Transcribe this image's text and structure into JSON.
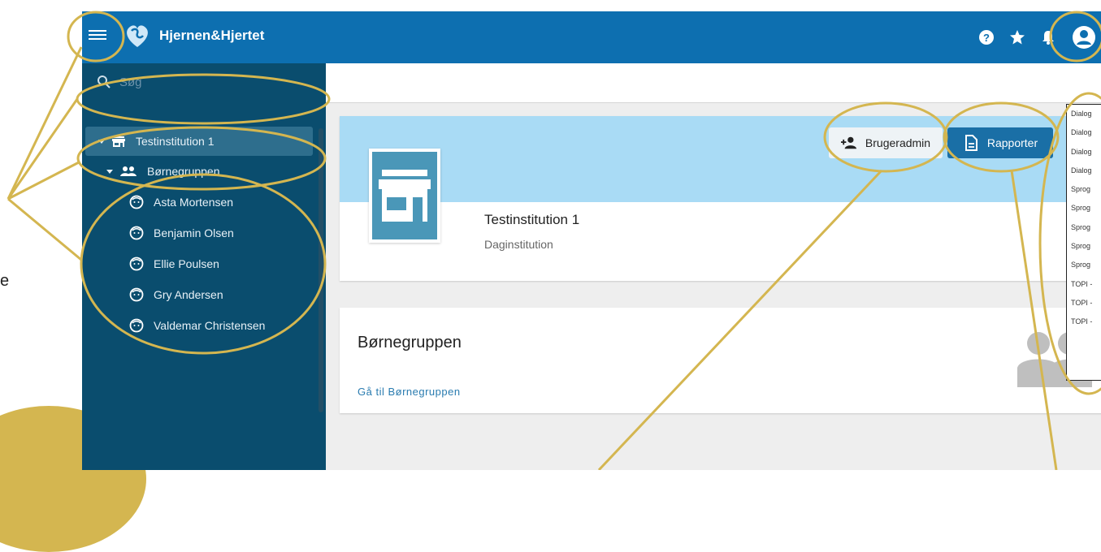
{
  "page": {
    "side_text": "e"
  },
  "topbar": {
    "menu_icon": "hamburger-menu-icon",
    "brand": "Hjernen&Hjertet",
    "icons": [
      "help-icon",
      "star-icon",
      "bell-icon",
      "account-icon"
    ]
  },
  "sidebar": {
    "search_placeholder": "Søg",
    "institution": "Testinstitution 1",
    "group": "Børnegruppen",
    "children": [
      "Asta Mortensen",
      "Benjamin Olsen",
      "Ellie Poulsen",
      "Gry Andersen",
      "Valdemar Christensen"
    ]
  },
  "institution_card": {
    "name": "Testinstitution 1",
    "type": "Daginstitution",
    "admin_button": "Brugeradmin",
    "reports_button": "Rapporter"
  },
  "reports_menu": [
    "Dialog",
    "Dialog",
    "Dialog",
    "Dialog",
    "Sprog",
    "Sprog",
    "Sprog",
    "Sprog",
    "Sprog",
    "TOPI -",
    "TOPI -",
    "TOPI -"
  ],
  "group_card": {
    "title": "Børnegruppen",
    "link": "Gå til Børnegruppen"
  },
  "colors": {
    "topbar": "#0d6fb0",
    "sidebar": "#0a4d6e",
    "banner": "#a9dbf5",
    "accent_button": "#1a6fa6",
    "annotation": "#d4b650"
  }
}
